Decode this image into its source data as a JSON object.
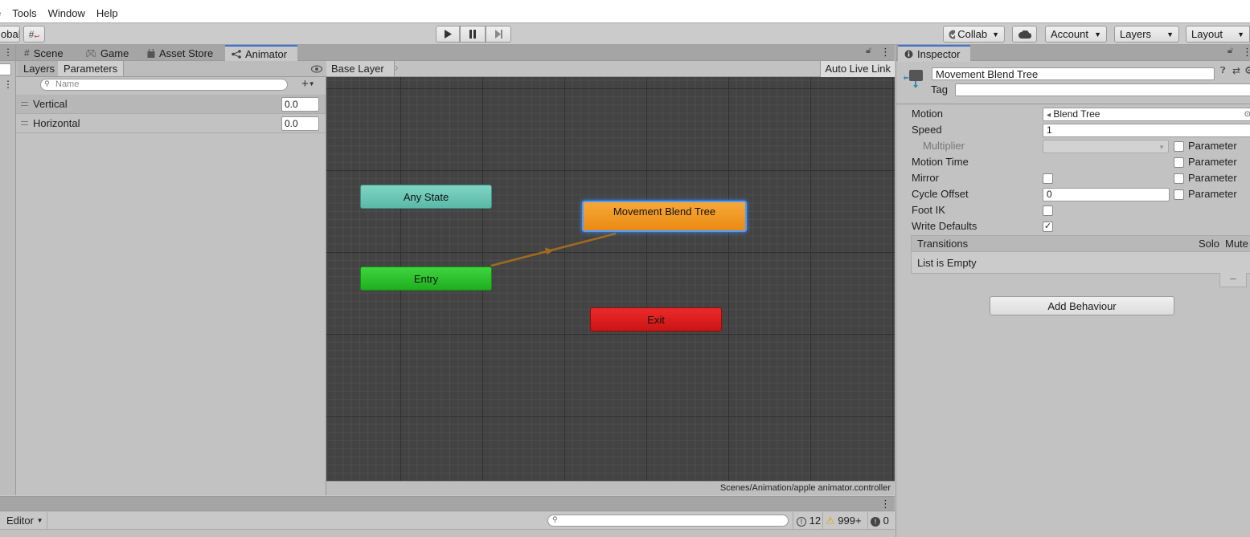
{
  "menu": {
    "items": [
      "e",
      "Tools",
      "Window",
      "Help"
    ]
  },
  "toolbar": {
    "left_label": "obal",
    "collab": "Collab",
    "account": "Account",
    "layers": "Layers",
    "layout": "Layout"
  },
  "tabs": {
    "scene": "Scene",
    "game": "Game",
    "asset_store": "Asset Store",
    "animator": "Animator",
    "inspector": "Inspector"
  },
  "animator": {
    "subtabs": {
      "layers": "Layers",
      "parameters": "Parameters"
    },
    "search_placeholder": "Name",
    "parameters": [
      {
        "name": "Vertical",
        "value": "0.0"
      },
      {
        "name": "Horizontal",
        "value": "0.0"
      }
    ],
    "breadcrumb": "Base Layer",
    "auto_live_link": "Auto Live Link",
    "nodes": {
      "any_state": "Any State",
      "entry": "Entry",
      "movement": "Movement Blend Tree",
      "exit": "Exit"
    },
    "path": "Scenes/Animation/apple animator.controller"
  },
  "inspector": {
    "name": "Movement Blend Tree",
    "tag_label": "Tag",
    "motion_label": "Motion",
    "motion_value": "Blend Tree",
    "speed_label": "Speed",
    "speed_value": "1",
    "multiplier_label": "Multiplier",
    "parameter_label": "Parameter",
    "motion_time_label": "Motion Time",
    "mirror_label": "Mirror",
    "cycle_offset_label": "Cycle Offset",
    "cycle_offset_value": "0",
    "foot_ik_label": "Foot IK",
    "write_defaults_label": "Write Defaults",
    "write_defaults_check": "✓",
    "transitions_label": "Transitions",
    "solo_label": "Solo",
    "mute_label": "Mute",
    "list_empty": "List is Empty",
    "minus": "–",
    "add_behaviour": "Add Behaviour"
  },
  "console": {
    "editor_label": "Editor",
    "count_info": "12",
    "count_warn": "999+",
    "count_error": "0"
  },
  "colors": {
    "any_state": "#6bc9b8",
    "entry": "#2cc52c",
    "movement": "#f29a1e",
    "exit": "#e01e1e",
    "selection": "#3a8cff"
  }
}
